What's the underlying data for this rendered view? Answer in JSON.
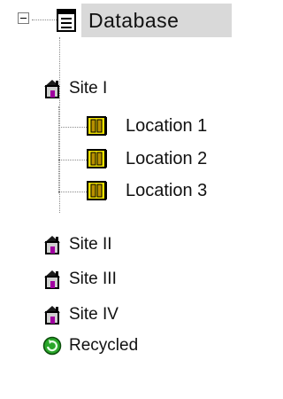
{
  "tree": {
    "root": {
      "label": "Database",
      "icon": "database-icon",
      "expanded": true,
      "selected": true
    },
    "sites": [
      {
        "label": "Site I",
        "icon": "house-icon",
        "expanded": true,
        "children": [
          {
            "label": "Location 1",
            "icon": "location-door-icon"
          },
          {
            "label": "Location 2",
            "icon": "location-door-icon"
          },
          {
            "label": "Location 3",
            "icon": "location-door-icon"
          }
        ]
      },
      {
        "label": "Site II",
        "icon": "house-icon"
      },
      {
        "label": "Site III",
        "icon": "house-icon"
      },
      {
        "label": "Site IV",
        "icon": "house-icon"
      }
    ],
    "recycled": {
      "label": "Recycled",
      "icon": "recycle-icon"
    }
  },
  "colors": {
    "selection_bg": "#d9d9d9",
    "house_roof": "#1a1a1a",
    "house_door": "#a000a0",
    "location_yellow": "#f2e200",
    "recycle_green": "#2aa62a"
  }
}
